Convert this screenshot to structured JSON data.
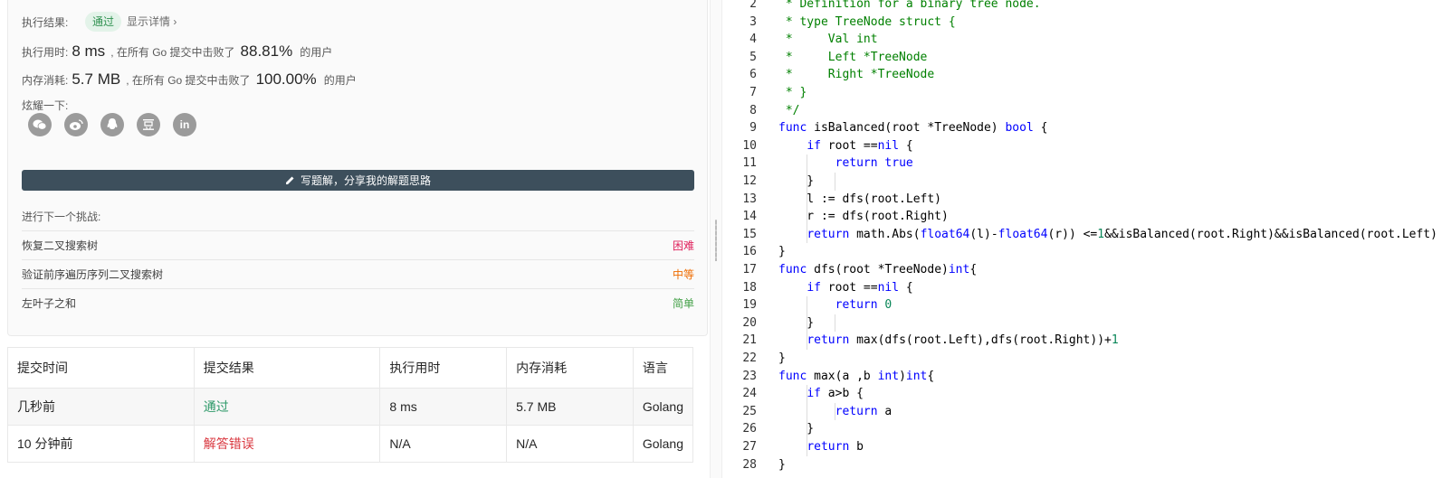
{
  "result": {
    "label": "执行结果:",
    "status": "通过",
    "details": "显示详情 ›"
  },
  "runtime": {
    "label": "执行用时:",
    "value": "8 ms",
    "middle": ", 在所有 Go 提交中击败了",
    "percent": "88.81%",
    "suffix": "的用户"
  },
  "memory": {
    "label": "内存消耗:",
    "value": "5.7 MB",
    "middle": ", 在所有 Go 提交中击败了",
    "percent": "100.00%",
    "suffix": "的用户"
  },
  "share": {
    "label": "炫耀一下:",
    "icons": [
      "wechat-icon",
      "weibo-icon",
      "qq-icon",
      "douban-icon",
      "linkedin-icon"
    ]
  },
  "write_button": "写题解，分享我的解题思路",
  "next_challenge": {
    "label": "进行下一个挑战:",
    "items": [
      {
        "title": "恢复二叉搜索树",
        "difficulty": "困难"
      },
      {
        "title": "验证前序遍历序列二叉搜索树",
        "difficulty": "中等"
      },
      {
        "title": "左叶子之和",
        "difficulty": "简单"
      }
    ]
  },
  "submissions": {
    "headers": [
      "提交时间",
      "提交结果",
      "执行用时",
      "内存消耗",
      "语言"
    ],
    "rows": [
      {
        "time": "几秒前",
        "result": "通过",
        "runtime": "8 ms",
        "memory": "5.7 MB",
        "lang": "Golang"
      },
      {
        "time": "10 分钟前",
        "result": "解答错误",
        "runtime": "N/A",
        "memory": "N/A",
        "lang": "Golang"
      }
    ]
  },
  "code_lines": [
    {
      "n": "2",
      "t": " * Definition for a binary tree node."
    },
    {
      "n": "3",
      "t": " * type TreeNode struct {"
    },
    {
      "n": "4",
      "t": " *     Val int"
    },
    {
      "n": "5",
      "t": " *     Left *TreeNode"
    },
    {
      "n": "6",
      "t": " *     Right *TreeNode"
    },
    {
      "n": "7",
      "t": " * }"
    },
    {
      "n": "8",
      "t": " */"
    },
    {
      "n": "9",
      "t": "func isBalanced(root *TreeNode) bool {"
    },
    {
      "n": "10",
      "t": "    if root ==nil {"
    },
    {
      "n": "11",
      "t": "        return true"
    },
    {
      "n": "12",
      "t": "    }"
    },
    {
      "n": "13",
      "t": "    l := dfs(root.Left)"
    },
    {
      "n": "14",
      "t": "    r := dfs(root.Right)"
    },
    {
      "n": "15",
      "t": "    return math.Abs(float64(l)-float64(r)) <=1&&isBalanced(root.Right)&&isBalanced(root.Left)"
    },
    {
      "n": "16",
      "t": "}"
    },
    {
      "n": "17",
      "t": "func dfs(root *TreeNode)int{"
    },
    {
      "n": "18",
      "t": "    if root ==nil {"
    },
    {
      "n": "19",
      "t": "        return 0"
    },
    {
      "n": "20",
      "t": "    }"
    },
    {
      "n": "21",
      "t": "    return max(dfs(root.Left),dfs(root.Right))+1"
    },
    {
      "n": "22",
      "t": "}"
    },
    {
      "n": "23",
      "t": "func max(a ,b int)int{"
    },
    {
      "n": "24",
      "t": "    if a>b {"
    },
    {
      "n": "25",
      "t": "        return a"
    },
    {
      "n": "26",
      "t": "    }"
    },
    {
      "n": "27",
      "t": "    return b"
    },
    {
      "n": "28",
      "t": "}"
    }
  ]
}
